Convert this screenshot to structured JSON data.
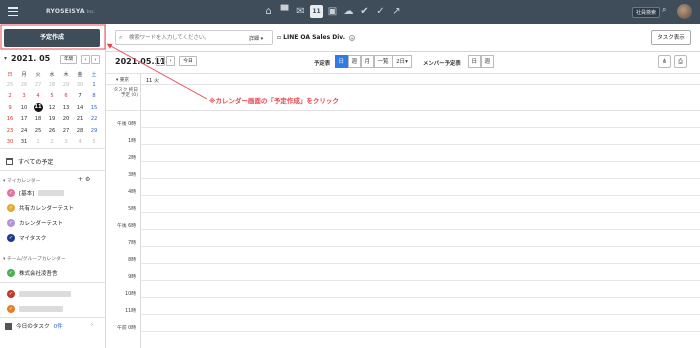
{
  "topbar": {
    "logo": "RYOSEISYA",
    "logo_sub": "Inc.",
    "calendar_day": "11",
    "employee_search": "社員検索"
  },
  "sidebar": {
    "create_button": "予定作成",
    "month_label": "2021. 05",
    "year_button": "年間",
    "weekdays": [
      "日",
      "月",
      "火",
      "水",
      "木",
      "金",
      "土"
    ],
    "weeks": [
      [
        "25",
        "26",
        "27",
        "28",
        "29",
        "30",
        "1"
      ],
      [
        "2",
        "3",
        "4",
        "5",
        "6",
        "7",
        "8"
      ],
      [
        "9",
        "10",
        "11",
        "12",
        "13",
        "14",
        "15"
      ],
      [
        "16",
        "17",
        "18",
        "19",
        "20",
        "21",
        "22"
      ],
      [
        "23",
        "24",
        "25",
        "26",
        "27",
        "28",
        "29"
      ],
      [
        "30",
        "31",
        "1",
        "2",
        "3",
        "4",
        "5"
      ]
    ],
    "all_schedules": "すべての予定",
    "my_calendar_header": "マイカレンダー",
    "my_calendars": [
      {
        "label": "[基本]",
        "color": "#e870a3"
      },
      {
        "label": "共有カレンダーテスト",
        "color": "#e3a93a"
      },
      {
        "label": "カレンダーテスト",
        "color": "#b293d8"
      },
      {
        "label": "マイタスク",
        "color": "#1e3a8f"
      }
    ],
    "team_calendar_header": "チーム/グループカレンダー",
    "team_calendars": [
      {
        "label": "株式会社凌吾舎",
        "color": "#4caf50"
      }
    ],
    "other_calendar_colors": [
      "#c0392b",
      "#e67e22"
    ],
    "today_tasks_label": "今日のタスク",
    "today_tasks_count": "0件"
  },
  "main": {
    "search_placeholder": "検索ワードを入力してください。",
    "detail_label": "詳細",
    "calendar_name": "LINE OA Sales Div.",
    "task_display_button": "タスク表示",
    "current_date": "2021.05.11",
    "today_button": "今日",
    "schedule_label": "予定表",
    "schedule_views": [
      "日",
      "週",
      "月",
      "一覧",
      "2日"
    ],
    "member_label": "メンバー予定表",
    "member_views": [
      "日",
      "週"
    ],
    "timezone": "東京",
    "day_header": "11 火",
    "allday_label": "タスク 終日予定 ",
    "allday_sub": "(0)",
    "hours": [
      "午後 0時",
      "1時",
      "2時",
      "3時",
      "4時",
      "5時",
      "午後 6時",
      "7時",
      "8時",
      "9時",
      "10時",
      "11時",
      "午前 0時"
    ]
  },
  "annotation": {
    "text": "※カレンダー画面の「予定作成」をクリック",
    "color": "#e8434c"
  }
}
